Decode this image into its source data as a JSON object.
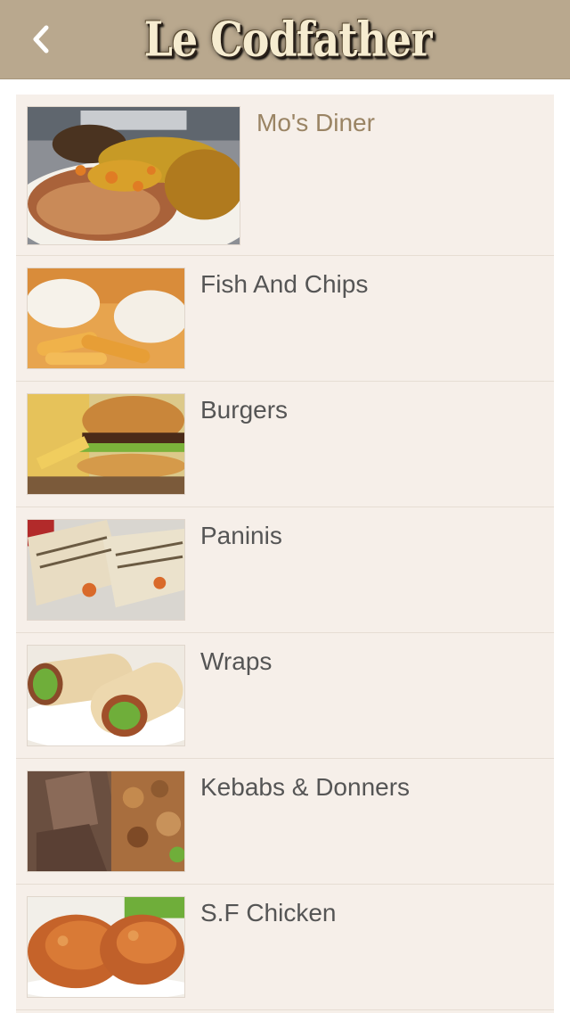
{
  "header": {
    "back_icon": "chevron-left-icon",
    "logo_text": "Le Codfather"
  },
  "colors": {
    "header_bg": "#b9a88e",
    "list_bg": "#f6efe9",
    "featured_text": "#9a8464",
    "item_text": "#555555"
  },
  "menu": {
    "featured": {
      "label": "Mo's Diner"
    },
    "items": [
      {
        "label": "Fish And Chips"
      },
      {
        "label": "Burgers"
      },
      {
        "label": "Paninis"
      },
      {
        "label": "Wraps"
      },
      {
        "label": "Kebabs & Donners"
      },
      {
        "label": "S.F Chicken"
      }
    ]
  }
}
